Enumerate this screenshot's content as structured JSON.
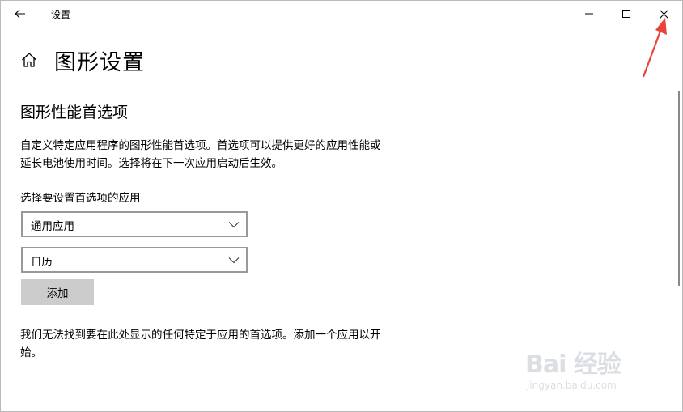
{
  "window": {
    "title": "设置"
  },
  "header": {
    "page_title": "图形设置",
    "home_icon": "home-icon"
  },
  "section": {
    "title": "图形性能首选项",
    "description": "自定义特定应用程序的图形性能首选项。首选项可以提供更好的应用性能或延长电池使用时间。选择将在下一次应用启动后生效。",
    "select_label": "选择要设置首选项的应用",
    "app_type_dropdown": {
      "selected": "通用应用"
    },
    "app_dropdown": {
      "selected": "日历"
    },
    "add_button": "添加",
    "empty_message": "我们无法找到要在此处显示的任何特定于应用的首选项。添加一个应用以开始。"
  },
  "watermark": {
    "brand": "Bai 经验",
    "url": "jingyan.baidu.com"
  },
  "colors": {
    "annotation_arrow": "#e8443a",
    "button_bg": "#cccccc",
    "dropdown_border": "#999999"
  }
}
